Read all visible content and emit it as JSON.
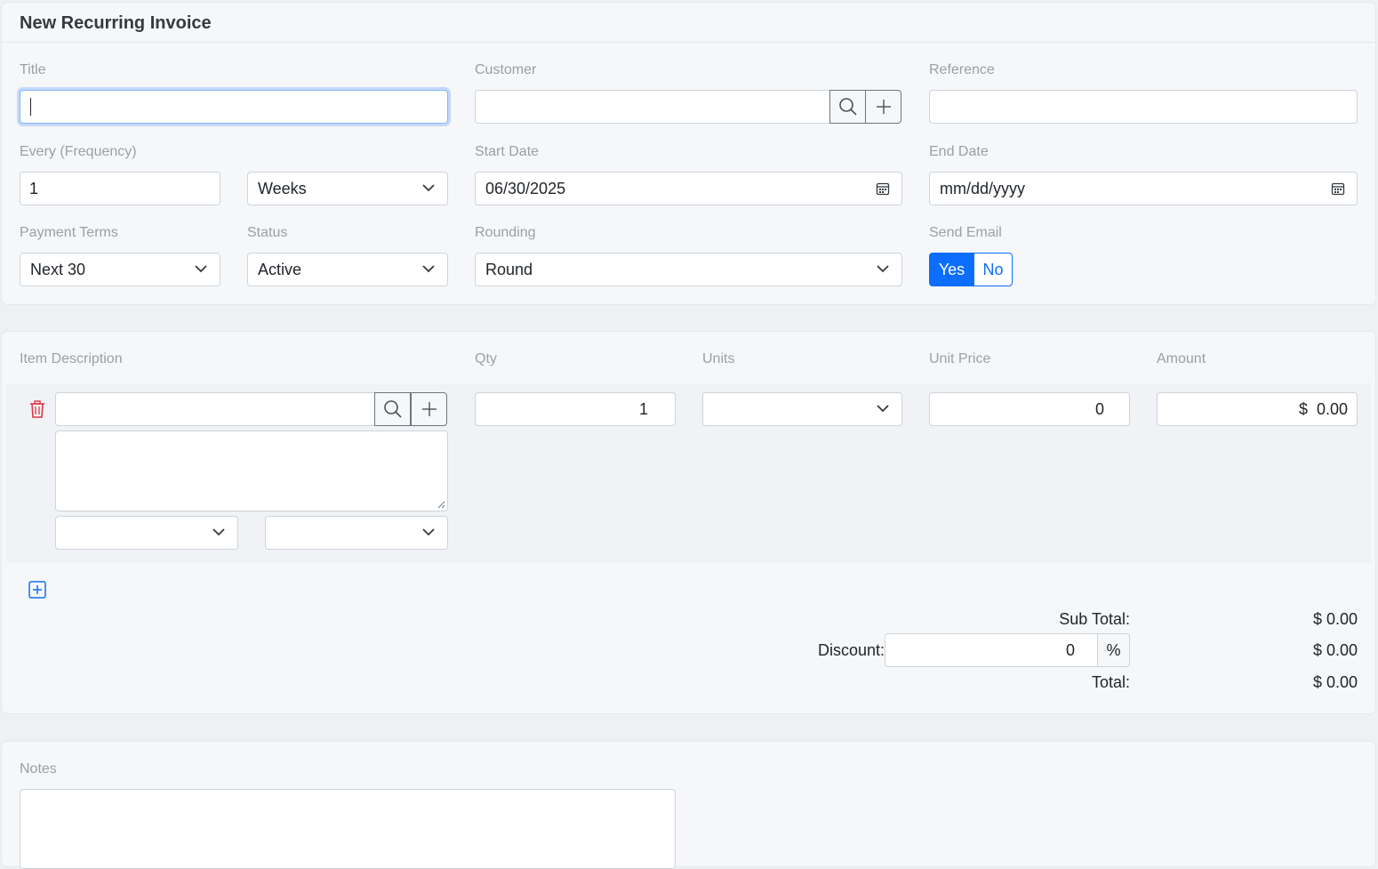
{
  "header": {
    "title": "New Recurring Invoice"
  },
  "form": {
    "title_label": "Title",
    "title_value": "",
    "customer_label": "Customer",
    "customer_value": "",
    "reference_label": "Reference",
    "reference_value": "",
    "frequency_label": "Every (Frequency)",
    "frequency_value": "1",
    "frequency_unit": "Weeks",
    "start_date_label": "Start Date",
    "start_date_value": "06/30/2025",
    "end_date_label": "End Date",
    "end_date_placeholder": "mm/dd/yyyy",
    "payment_terms_label": "Payment Terms",
    "payment_terms_value": "Next 30",
    "status_label": "Status",
    "status_value": "Active",
    "rounding_label": "Rounding",
    "rounding_value": "Round",
    "send_email_label": "Send Email",
    "send_email_yes": "Yes",
    "send_email_no": "No",
    "send_email_selected": "Yes"
  },
  "items": {
    "columns": {
      "description": "Item Description",
      "qty": "Qty",
      "units": "Units",
      "unit_price": "Unit Price",
      "amount": "Amount"
    },
    "rows": [
      {
        "description": "",
        "notes": "",
        "qty": "1",
        "units": "",
        "unit_price": "0",
        "amount": "$  0.00"
      }
    ]
  },
  "totals": {
    "subtotal_label": "Sub Total:",
    "subtotal_value": "$ 0.00",
    "discount_label": "Discount:",
    "discount_input": "0",
    "discount_unit": "%",
    "discount_value": "$ 0.00",
    "total_label": "Total:",
    "total_value": "$ 0.00"
  },
  "notes": {
    "label": "Notes",
    "value": ""
  },
  "colors": {
    "accent": "#0d6efd",
    "danger": "#dc3545"
  }
}
